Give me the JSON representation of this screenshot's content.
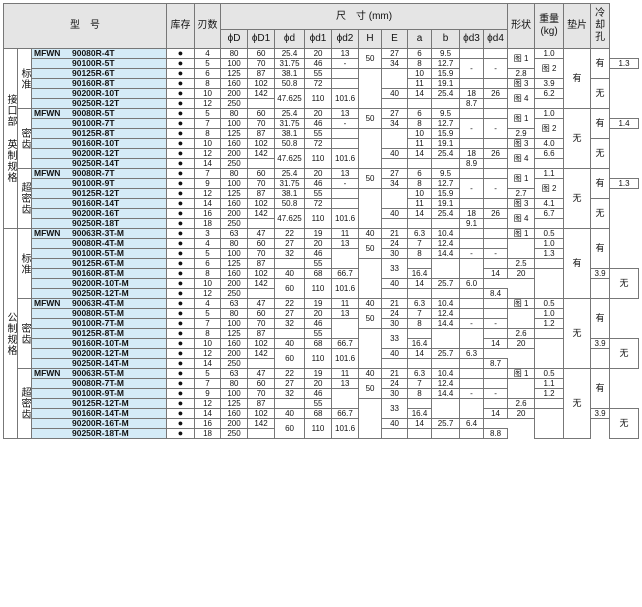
{
  "header": {
    "model": "型　号",
    "stock": "库存",
    "teeth": "刃数",
    "dims": "尺　寸 (mm)",
    "phiD": "ϕD",
    "phiD1": "ϕD1",
    "phid": "ϕd",
    "phid1": "ϕd1",
    "phid2": "ϕd2",
    "H": "H",
    "E": "E",
    "a": "a",
    "b": "b",
    "phid3": "ϕd3",
    "phid4": "ϕd4",
    "shape": "形状",
    "weight": "重量 (kg)",
    "pad": "垫片",
    "coolant": "冷却孔"
  },
  "stock_symbol": "●",
  "groups": [
    {
      "label": "接口部 英制规格",
      "subs": [
        {
          "label": "标准",
          "pad": "有",
          "coolant": [
            "有",
            "无"
          ],
          "rows": [
            [
              "MFWN",
              "90080R-4T",
              "4",
              "80",
              "60",
              "25.4",
              "20",
              "13",
              "50",
              "27",
              "6",
              "9.5",
              "",
              "",
              "图 1",
              "1.0"
            ],
            [
              "",
              "90100R-5T",
              "5",
              "100",
              "70",
              "31.75",
              "46",
              "-",
              "",
              "34",
              "8",
              "12.7",
              "-",
              "-",
              "图 2",
              "1.3"
            ],
            [
              "",
              "90125R-6T",
              "6",
              "125",
              "87",
              "38.1",
              "55",
              "",
              "",
              "",
              "10",
              "15.9",
              "",
              "",
              "",
              "2.8"
            ],
            [
              "",
              "90160R-8T",
              "8",
              "160",
              "102",
              "50.8",
              "72",
              "",
              "63",
              "38",
              "11",
              "19.1",
              "",
              "",
              "图 3",
              "3.9"
            ],
            [
              "",
              "90200R-10T",
              "10",
              "200",
              "142",
              "47.625",
              "110",
              "101.6",
              "",
              "40",
              "14",
              "25.4",
              "18",
              "26",
              "图 4",
              "6.2"
            ],
            [
              "",
              "90250R-12T",
              "12",
              "250",
              "",
              "",
              "",
              "",
              "",
              "",
              "",
              "",
              "",
              "",
              "",
              "8.7"
            ]
          ]
        },
        {
          "label": "密齿",
          "pad": "无",
          "coolant": [
            "有",
            "无"
          ],
          "rows": [
            [
              "MFWN",
              "90080R-5T",
              "5",
              "80",
              "60",
              "25.4",
              "20",
              "13",
              "50",
              "27",
              "6",
              "9.5",
              "",
              "",
              "图 1",
              "1.0"
            ],
            [
              "",
              "90100R-7T",
              "7",
              "100",
              "70",
              "31.75",
              "46",
              "-",
              "",
              "34",
              "8",
              "12.7",
              "-",
              "-",
              "图 2",
              "1.4"
            ],
            [
              "",
              "90125R-8T",
              "8",
              "125",
              "87",
              "38.1",
              "55",
              "",
              "",
              "",
              "10",
              "15.9",
              "",
              "",
              "",
              "2.9"
            ],
            [
              "",
              "90160R-10T",
              "10",
              "160",
              "102",
              "50.8",
              "72",
              "",
              "63",
              "38",
              "11",
              "19.1",
              "",
              "",
              "图 3",
              "4.0"
            ],
            [
              "",
              "90200R-12T",
              "12",
              "200",
              "142",
              "47.625",
              "110",
              "101.6",
              "",
              "40",
              "14",
              "25.4",
              "18",
              "26",
              "图 4",
              "6.6"
            ],
            [
              "",
              "90250R-14T",
              "14",
              "250",
              "",
              "",
              "",
              "",
              "",
              "",
              "",
              "",
              "",
              "",
              "",
              "8.9"
            ]
          ]
        },
        {
          "label": "超密齿",
          "pad": "无",
          "coolant": [
            "有",
            "无"
          ],
          "rows": [
            [
              "MFWN",
              "90080R-7T",
              "7",
              "80",
              "60",
              "25.4",
              "20",
              "13",
              "50",
              "27",
              "6",
              "9.5",
              "",
              "",
              "图 1",
              "1.1"
            ],
            [
              "",
              "90100R-9T",
              "9",
              "100",
              "70",
              "31.75",
              "46",
              "-",
              "",
              "34",
              "8",
              "12.7",
              "-",
              "-",
              "图 2",
              "1.3"
            ],
            [
              "",
              "90125R-12T",
              "12",
              "125",
              "87",
              "38.1",
              "55",
              "",
              "",
              "",
              "10",
              "15.9",
              "",
              "",
              "",
              "2.7"
            ],
            [
              "",
              "90160R-14T",
              "14",
              "160",
              "102",
              "50.8",
              "72",
              "",
              "63",
              "38",
              "11",
              "19.1",
              "",
              "",
              "图 3",
              "4.1"
            ],
            [
              "",
              "90200R-16T",
              "16",
              "200",
              "142",
              "47.625",
              "110",
              "101.6",
              "",
              "40",
              "14",
              "25.4",
              "18",
              "26",
              "图 4",
              "6.7"
            ],
            [
              "",
              "90250R-18T",
              "18",
              "250",
              "",
              "",
              "",
              "",
              "",
              "",
              "",
              "",
              "",
              "",
              "",
              "9.1"
            ]
          ]
        }
      ]
    },
    {
      "label": "公制规格",
      "subs": [
        {
          "label": "标准",
          "pad": "有",
          "coolant": [
            "有",
            "无"
          ],
          "rows": [
            [
              "MFWN",
              "90063R-3T-M",
              "3",
              "63",
              "47",
              "22",
              "19",
              "11",
              "40",
              "21",
              "6.3",
              "10.4",
              "",
              "",
              "图 1",
              "0.5"
            ],
            [
              "",
              "90080R-4T-M",
              "4",
              "80",
              "60",
              "27",
              "20",
              "13",
              "50",
              "24",
              "7",
              "12.4",
              "",
              "",
              "",
              "1.0"
            ],
            [
              "",
              "90100R-5T-M",
              "5",
              "100",
              "70",
              "32",
              "46",
              "",
              "",
              "30",
              "8",
              "14.4",
              "-",
              "-",
              "图 2",
              "1.3"
            ],
            [
              "",
              "90125R-6T-M",
              "6",
              "125",
              "87",
              "",
              "55",
              "-",
              "",
              "33",
              "",
              "",
              "",
              "",
              "",
              "2.5"
            ],
            [
              "",
              "90160R-8T-M",
              "8",
              "160",
              "102",
              "40",
              "68",
              "66.7",
              "63",
              "32",
              "9",
              "16.4",
              "14",
              "20",
              "",
              "3.9"
            ],
            [
              "",
              "90200R-10T-M",
              "10",
              "200",
              "142",
              "60",
              "110",
              "101.6",
              "",
              "40",
              "14",
              "25.7",
              "18",
              "26",
              "图 4",
              "6.0"
            ],
            [
              "",
              "90250R-12T-M",
              "12",
              "250",
              "",
              "",
              "",
              "",
              "",
              "",
              "",
              "",
              "",
              "",
              "",
              "8.4"
            ]
          ]
        },
        {
          "label": "密齿",
          "pad": "无",
          "coolant": [
            "有",
            "无"
          ],
          "rows": [
            [
              "MFWN",
              "90063R-4T-M",
              "4",
              "63",
              "47",
              "22",
              "19",
              "11",
              "40",
              "21",
              "6.3",
              "10.4",
              "",
              "",
              "图 1",
              "0.5"
            ],
            [
              "",
              "90080R-5T-M",
              "5",
              "80",
              "60",
              "27",
              "20",
              "13",
              "50",
              "24",
              "7",
              "12.4",
              "",
              "",
              "",
              "1.0"
            ],
            [
              "",
              "90100R-7T-M",
              "7",
              "100",
              "70",
              "32",
              "46",
              "",
              "",
              "30",
              "8",
              "14.4",
              "-",
              "-",
              "图 2",
              "1.2"
            ],
            [
              "",
              "90125R-8T-M",
              "8",
              "125",
              "87",
              "",
              "55",
              "-",
              "",
              "33",
              "",
              "",
              "",
              "",
              "",
              "2.6"
            ],
            [
              "",
              "90160R-10T-M",
              "10",
              "160",
              "102",
              "40",
              "68",
              "66.7",
              "63",
              "32",
              "9",
              "16.4",
              "14",
              "20",
              "",
              "3.9"
            ],
            [
              "",
              "90200R-12T-M",
              "12",
              "200",
              "142",
              "60",
              "110",
              "101.6",
              "",
              "40",
              "14",
              "25.7",
              "18",
              "26",
              "图 4",
              "6.3"
            ],
            [
              "",
              "90250R-14T-M",
              "14",
              "250",
              "",
              "",
              "",
              "",
              "",
              "",
              "",
              "",
              "",
              "",
              "",
              "8.7"
            ]
          ]
        },
        {
          "label": "超密齿",
          "pad": "无",
          "coolant": [
            "有",
            "无"
          ],
          "rows": [
            [
              "MFWN",
              "90063R-5T-M",
              "5",
              "63",
              "47",
              "22",
              "19",
              "11",
              "40",
              "21",
              "6.3",
              "10.4",
              "",
              "",
              "图 1",
              "0.5"
            ],
            [
              "",
              "90080R-7T-M",
              "7",
              "80",
              "60",
              "27",
              "20",
              "13",
              "50",
              "24",
              "7",
              "12.4",
              "",
              "",
              "",
              "1.1"
            ],
            [
              "",
              "90100R-9T-M",
              "9",
              "100",
              "70",
              "32",
              "46",
              "",
              "",
              "30",
              "8",
              "14.4",
              "-",
              "-",
              "图 2",
              "1.2"
            ],
            [
              "",
              "90125R-12T-M",
              "12",
              "125",
              "87",
              "",
              "55",
              "-",
              "",
              "33",
              "",
              "",
              "",
              "",
              "",
              "2.6"
            ],
            [
              "",
              "90160R-14T-M",
              "14",
              "160",
              "102",
              "40",
              "68",
              "66.7",
              "63",
              "32",
              "9",
              "16.4",
              "14",
              "20",
              "",
              "3.9"
            ],
            [
              "",
              "90200R-16T-M",
              "16",
              "200",
              "142",
              "60",
              "110",
              "101.6",
              "",
              "40",
              "14",
              "25.7",
              "18",
              "26",
              "图 4",
              "6.4"
            ],
            [
              "",
              "90250R-18T-M",
              "18",
              "250",
              "",
              "",
              "",
              "",
              "",
              "",
              "",
              "",
              "",
              "",
              "",
              "8.8"
            ]
          ]
        }
      ]
    }
  ]
}
